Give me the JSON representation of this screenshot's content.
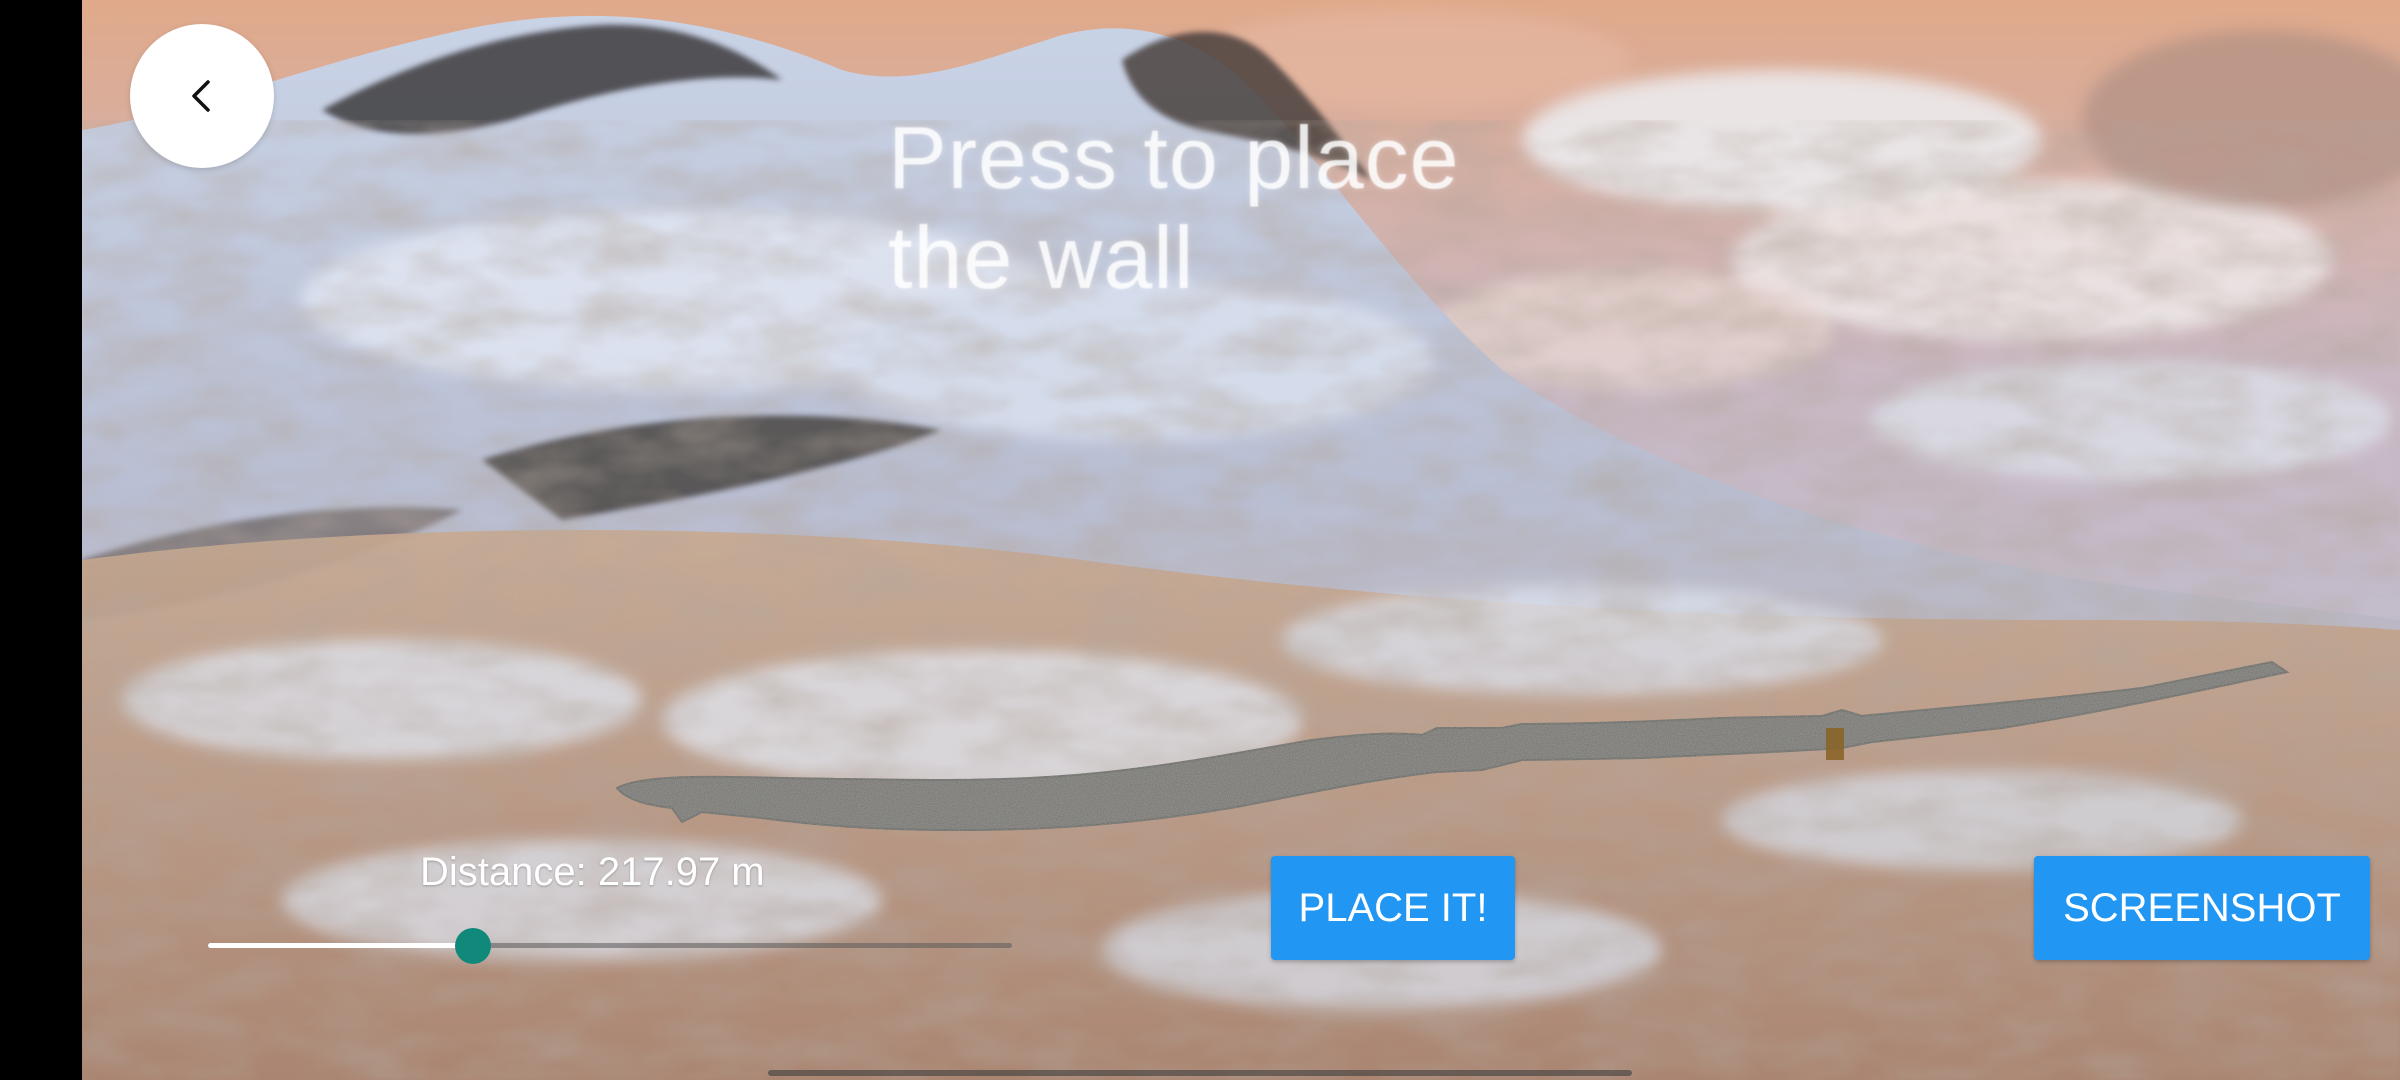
{
  "prompt": {
    "line1": "Press to place",
    "line2": "the wall"
  },
  "distance": {
    "label": "Distance: 217.97 m"
  },
  "slider": {
    "value_fraction": 0.33,
    "fill_color": "#ffffff",
    "thumb_color": "#10897a"
  },
  "buttons": {
    "place_label": "PLACE IT!",
    "screenshot_label": "SCREENSHOT",
    "color": "#2196f3"
  },
  "back_button": {
    "icon": "chevron-left-icon"
  }
}
